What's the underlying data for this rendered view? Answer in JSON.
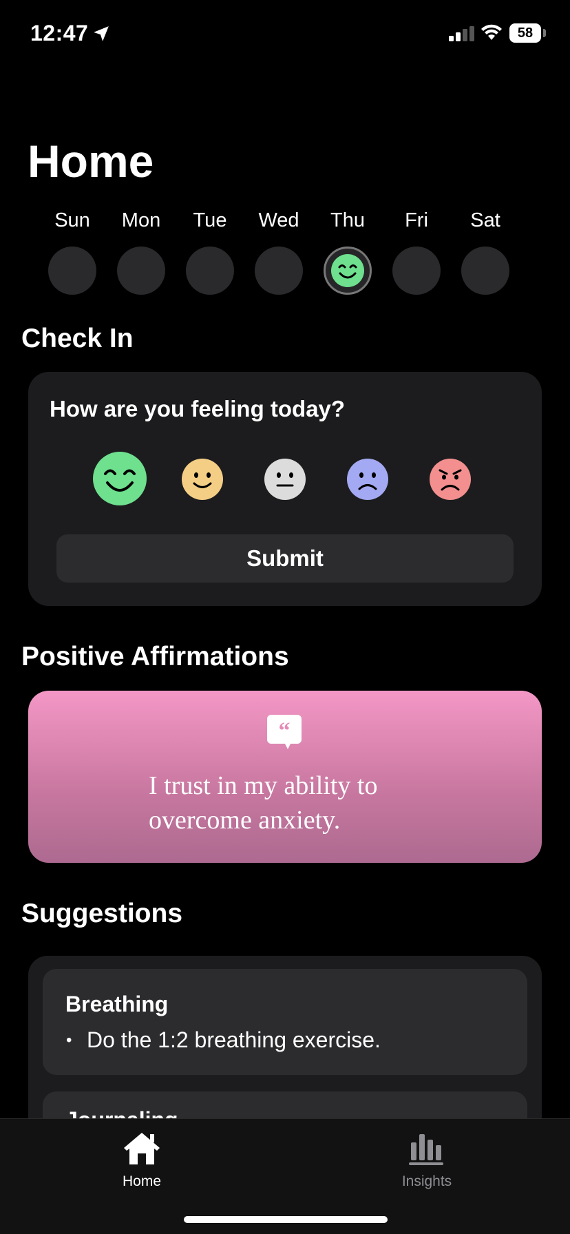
{
  "status_bar": {
    "time": "12:47",
    "battery": "58"
  },
  "header": {
    "title": "Home"
  },
  "week": {
    "days": [
      {
        "label": "Sun",
        "mood": null
      },
      {
        "label": "Mon",
        "mood": null
      },
      {
        "label": "Tue",
        "mood": null
      },
      {
        "label": "Wed",
        "mood": null
      },
      {
        "label": "Thu",
        "mood": "happy"
      },
      {
        "label": "Fri",
        "mood": null
      },
      {
        "label": "Sat",
        "mood": null
      }
    ],
    "selected": "Thu"
  },
  "check_in": {
    "title": "Check In",
    "question": "How are you feeling today?",
    "moods": [
      {
        "name": "happy",
        "color": "#6ee08e",
        "selected": true
      },
      {
        "name": "content",
        "color": "#f4ce84",
        "selected": false
      },
      {
        "name": "neutral",
        "color": "#dcdcdc",
        "selected": false
      },
      {
        "name": "sad",
        "color": "#a3a9f2",
        "selected": false
      },
      {
        "name": "angry",
        "color": "#f48f8f",
        "selected": false
      }
    ],
    "submit_label": "Submit"
  },
  "affirmations": {
    "title": "Positive Affirmations",
    "text": "I trust in my ability to overcome anxiety."
  },
  "suggestions": {
    "title": "Suggestions",
    "items": [
      {
        "title": "Breathing",
        "bullet": "Do the 1:2 breathing exercise."
      },
      {
        "title": "Journaling",
        "bullet": ""
      }
    ]
  },
  "tab_bar": {
    "tabs": [
      {
        "label": "Home",
        "active": true,
        "icon": "home-icon"
      },
      {
        "label": "Insights",
        "active": false,
        "icon": "chart-bars-icon"
      }
    ]
  },
  "colors": {
    "background": "#000000",
    "card": "#1c1c1e",
    "accent_pink": "#f497c6"
  }
}
